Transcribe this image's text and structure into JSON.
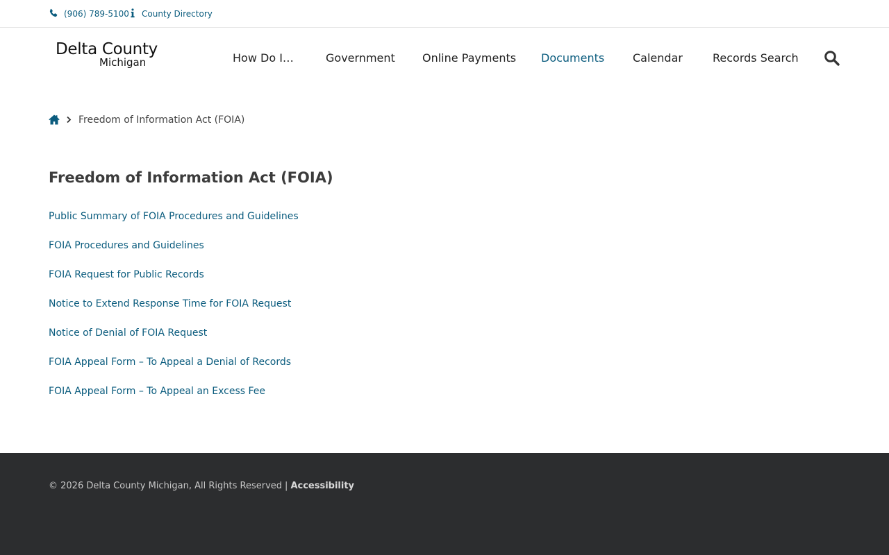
{
  "topbar": {
    "phone": "(906) 789-5100",
    "directory": "County Directory",
    "icon_phone": "phone-icon",
    "icon_info": "info-icon"
  },
  "logo": {
    "line1": "Delta County",
    "line2": "Michigan"
  },
  "nav": {
    "items": [
      {
        "label": "How Do I…"
      },
      {
        "label": "Government"
      },
      {
        "label": "Online Payments"
      },
      {
        "label": "Documents",
        "active": true
      },
      {
        "label": "Calendar"
      },
      {
        "label": "Records Search"
      }
    ],
    "search_icon": "search-icon"
  },
  "breadcrumb": {
    "home_icon": "home-icon",
    "separator_icon": "chevron-right-icon",
    "current": "Freedom of Information Act (FOIA)"
  },
  "page": {
    "title": "Freedom of Information Act (FOIA)",
    "links": [
      "Public Summary of FOIA Procedures and Guidelines",
      "FOIA Procedures and Guidelines",
      "FOIA Request for Public Records",
      "Notice to Extend Response Time for FOIA Request",
      "Notice of Denial of FOIA Request",
      "FOIA Appeal Form – To Appeal a Denial of Records",
      "FOIA Appeal Form – To Appeal an Excess Fee"
    ]
  },
  "footer": {
    "copyright": "© 2026 Delta County Michigan, All Rights Reserved",
    "separator": "|",
    "accessibility": "Accessibility"
  },
  "colors": {
    "link": "#0b5c7e",
    "footer_bg": "#2c2d2f",
    "title": "#3c3c3c"
  }
}
